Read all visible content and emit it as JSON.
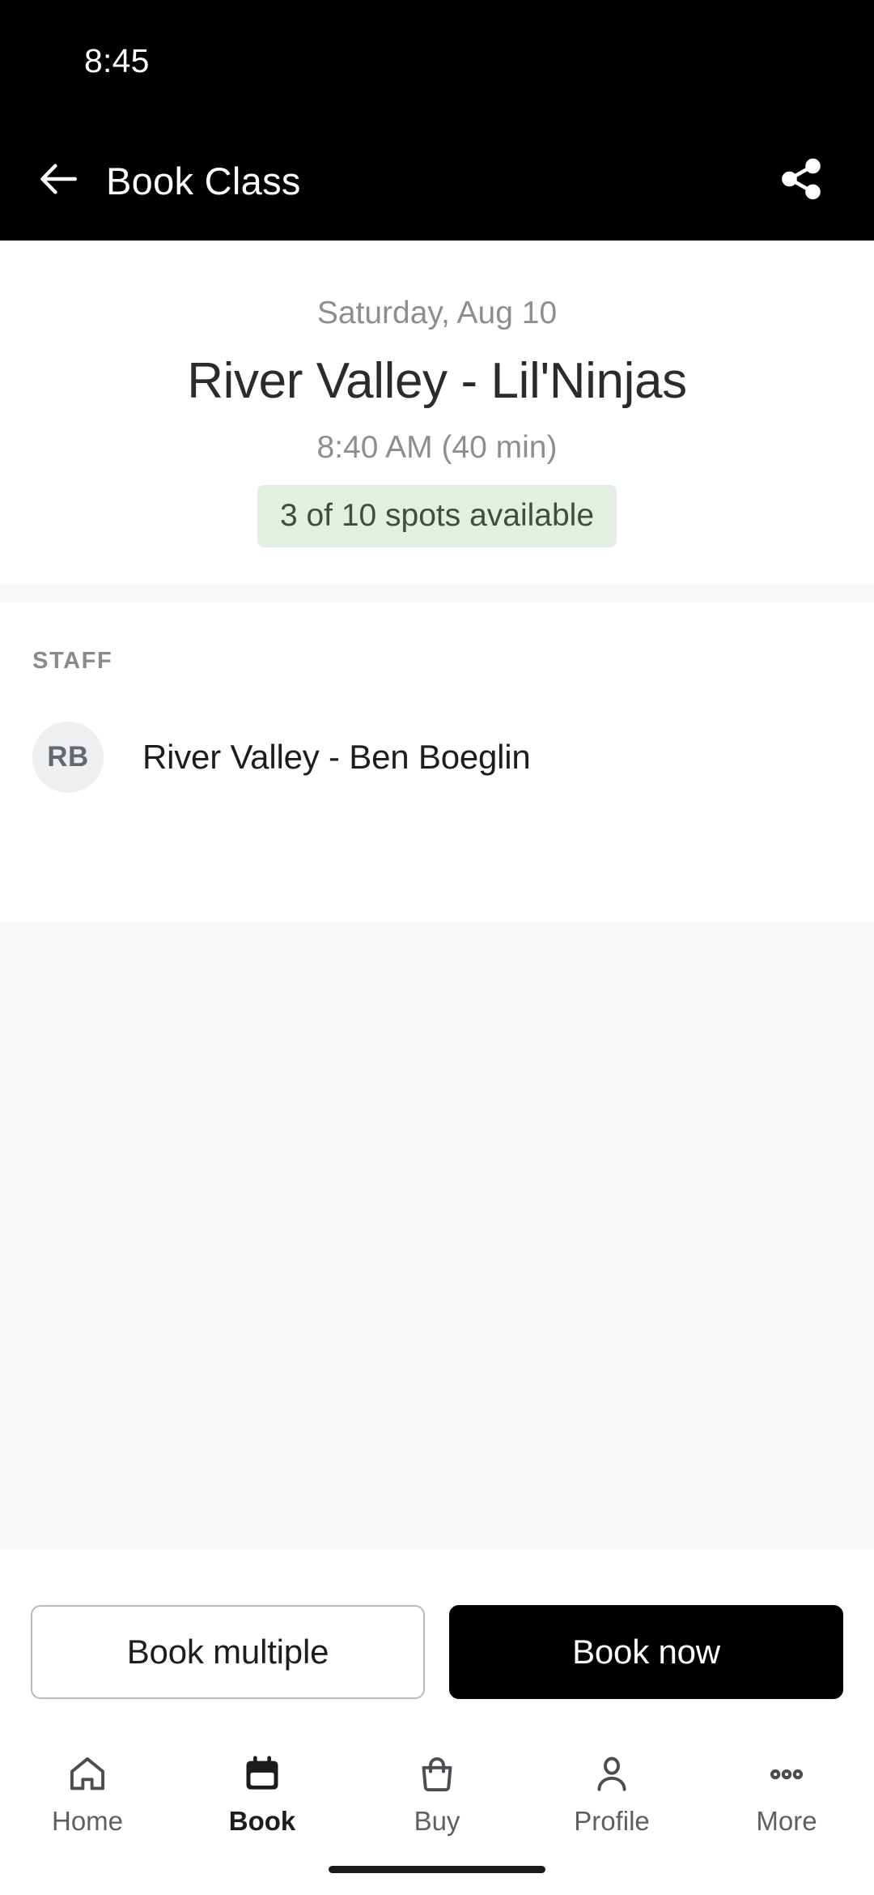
{
  "status_bar": {
    "time": "8:45"
  },
  "app_bar": {
    "title": "Book Class",
    "back_icon": "arrow-left-icon",
    "share_icon": "share-icon"
  },
  "class_summary": {
    "date": "Saturday, Aug 10",
    "name": "River Valley - Lil'Ninjas",
    "time": "8:40 AM (40 min)",
    "spots": "3 of 10 spots available",
    "spots_badge_bg": "#e4efe3",
    "spots_badge_text_color": "#3d4f3d"
  },
  "staff": {
    "section_label": "STAFF",
    "members": [
      {
        "initials": "RB",
        "name": "River Valley - Ben Boeglin"
      }
    ]
  },
  "actions": {
    "book_multiple_label": "Book multiple",
    "book_now_label": "Book now"
  },
  "bottom_nav": {
    "items": [
      {
        "label": "Home",
        "icon": "home-icon",
        "active": false
      },
      {
        "label": "Book",
        "icon": "calendar-icon",
        "active": true
      },
      {
        "label": "Buy",
        "icon": "bag-icon",
        "active": false
      },
      {
        "label": "Profile",
        "icon": "person-icon",
        "active": false
      },
      {
        "label": "More",
        "icon": "ellipsis-icon",
        "active": false
      }
    ]
  },
  "colors": {
    "header_bg": "#000000",
    "page_bg": "#ffffff",
    "section_bg": "#f7f8fa",
    "primary_button": "#000000",
    "muted_text": "#8e8e8e"
  }
}
